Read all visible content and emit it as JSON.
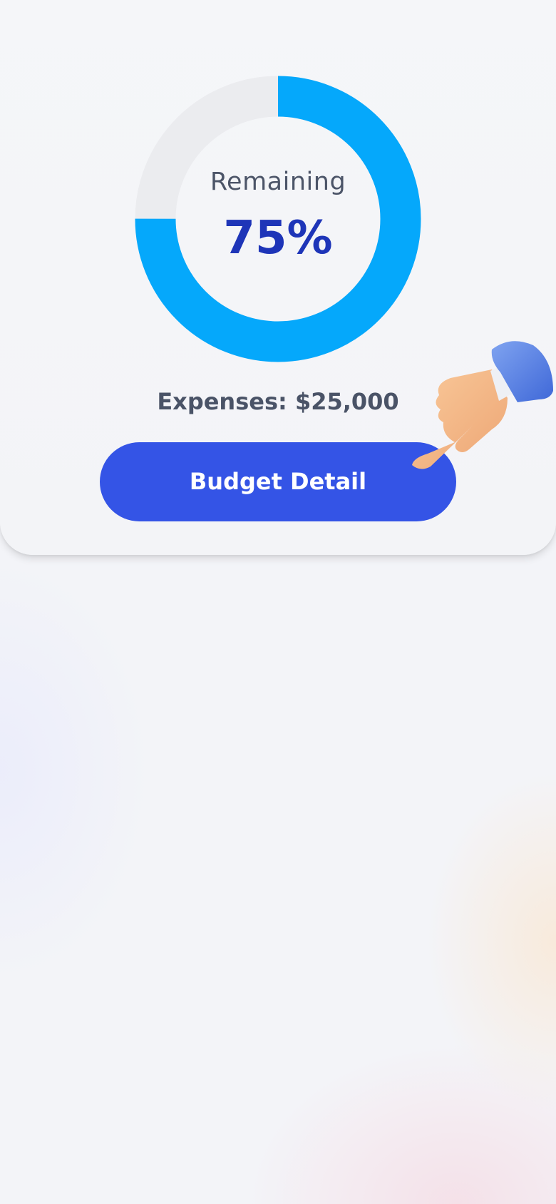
{
  "budget_card": {
    "remaining_label": "Remaining",
    "remaining_percent": 75,
    "remaining_percent_text": "75%",
    "expenses_text": "Expenses: $25,000",
    "button_label": "Budget Detail"
  },
  "colors": {
    "ring_filled": "#05a8fb",
    "ring_track": "#ebecef",
    "percent_text": "#1e35b8",
    "button_background": "#3454e6",
    "button_text": "#ffffff",
    "secondary_text": "#4c5568"
  },
  "icons": {
    "pointer": "pointing-hand-icon"
  }
}
